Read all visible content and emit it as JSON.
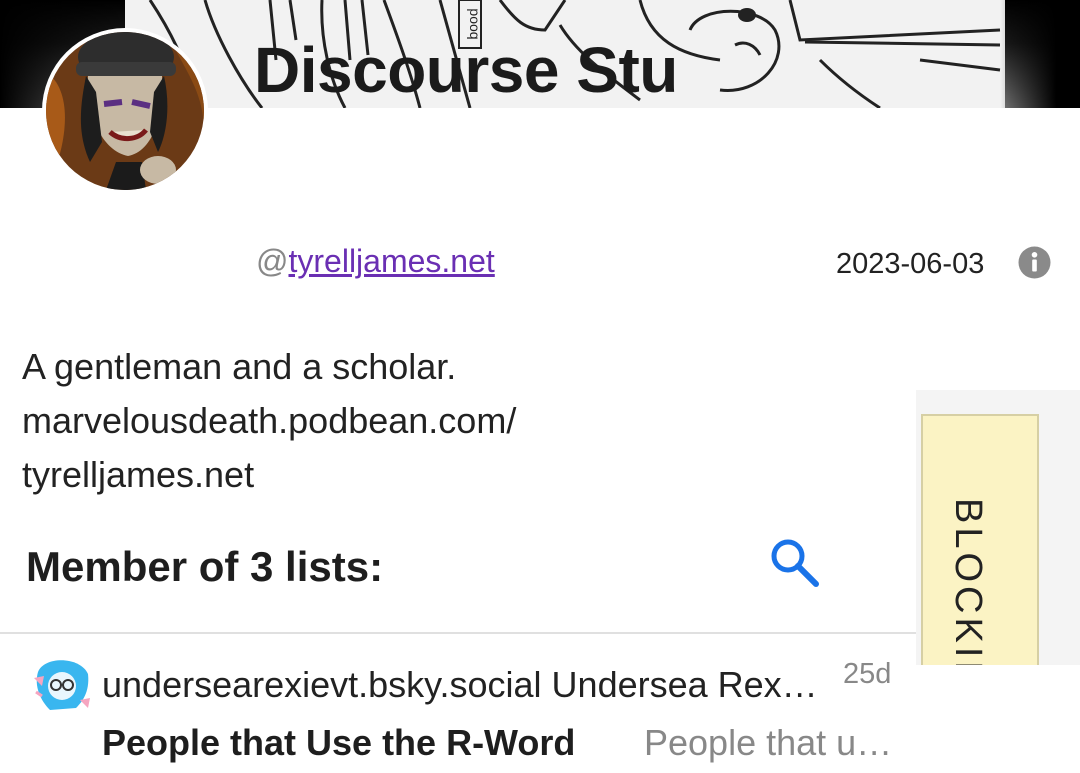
{
  "profile": {
    "display_name": "Discourse Stu",
    "handle_prefix": "@",
    "handle": "tyrelljames.net",
    "joined_date": "2023-06-03",
    "bio_lines": [
      "A gentleman and a scholar.",
      "marvelousdeath.podbean.com/",
      "tyrelljames.net"
    ]
  },
  "lists": {
    "heading": "Member of 3 lists:",
    "items": [
      {
        "owner": "undersearexievt.bsky.social Undersea Rexie VT",
        "age": "25d",
        "title": "People that Use the R-Word",
        "description": "People that use the R-Word"
      }
    ]
  },
  "side_tab": {
    "label": "BLOCKING"
  },
  "banner": {
    "visible_text": "pooq"
  },
  "colors": {
    "link": "#6a2fb3",
    "search_icon": "#1a73e8",
    "side_tab_bg": "#fbf3c4",
    "muted_text": "#888888"
  },
  "icons": {
    "info": "info-circle-icon",
    "search": "search-icon"
  }
}
